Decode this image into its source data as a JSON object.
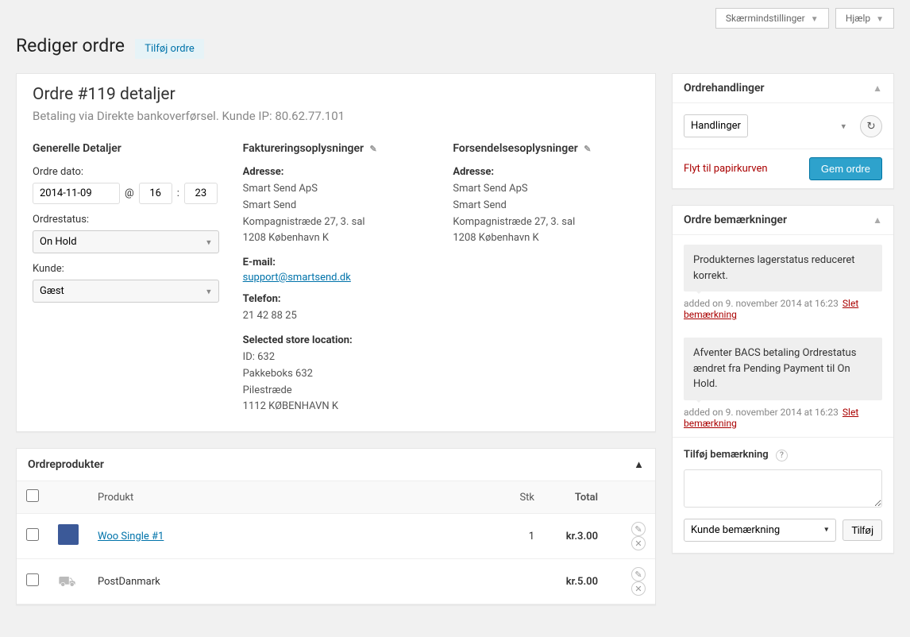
{
  "top": {
    "screen_options": "Skærmindstillinger",
    "help": "Hjælp"
  },
  "header": {
    "title": "Rediger ordre",
    "add_order": "Tilføj ordre"
  },
  "order": {
    "title": "Ordre #119 detaljer",
    "subtitle": "Betaling via Direkte bankoverførsel. Kunde IP: 80.62.77.101"
  },
  "general": {
    "heading": "Generelle Detaljer",
    "date_label": "Ordre dato:",
    "date_value": "2014-11-09",
    "at": "@",
    "hour": "16",
    "colon": ":",
    "minute": "23",
    "status_label": "Ordrestatus:",
    "status_value": "On Hold",
    "customer_label": "Kunde:",
    "customer_value": "Gæst"
  },
  "billing": {
    "heading": "Faktureringsoplysninger",
    "address_label": "Adresse:",
    "line1": "Smart Send ApS",
    "line2": "Smart Send",
    "line3": "Kompagnistræde 27, 3. sal",
    "line4": "1208 København K",
    "email_label": "E-mail:",
    "email": "support@smartsend.dk",
    "phone_label": "Telefon:",
    "phone": "21 42 88 25",
    "store_label": "Selected store location:",
    "store_id": "ID: 632",
    "store_name": "Pakkeboks 632",
    "store_street": "Pilestræde",
    "store_city": "1112 KØBENHAVN K"
  },
  "shipping": {
    "heading": "Forsendelsesoplysninger",
    "address_label": "Adresse:",
    "line1": "Smart Send ApS",
    "line2": "Smart Send",
    "line3": "Kompagnistræde 27, 3. sal",
    "line4": "1208 København K"
  },
  "items_box": {
    "heading": "Ordreprodukter",
    "col_product": "Produkt",
    "col_qty": "Stk",
    "col_total": "Total",
    "rows": [
      {
        "name": "Woo Single #1",
        "qty": "1",
        "total": "kr.3.00",
        "link": true
      },
      {
        "name": "PostDanmark",
        "qty": "",
        "total": "kr.5.00",
        "link": false
      }
    ]
  },
  "actions_box": {
    "heading": "Ordrehandlinger",
    "select_value": "Handlinger",
    "trash": "Flyt til papirkurven",
    "save": "Gem ordre"
  },
  "notes_box": {
    "heading": "Ordre bemærkninger",
    "notes": [
      {
        "text": "Produkternes lagerstatus reduceret korrekt.",
        "meta": "added on 9. november 2014 at 16:23",
        "delete": "Slet bemærkning"
      },
      {
        "text": "Afventer BACS betaling Ordrestatus ændret fra Pending Payment til On Hold.",
        "meta": "added on 9. november 2014 at 16:23",
        "delete": "Slet bemærkning"
      }
    ],
    "add_heading": "Tilføj bemærkning",
    "note_type": "Kunde bemærkning",
    "add_btn": "Tilføj"
  }
}
